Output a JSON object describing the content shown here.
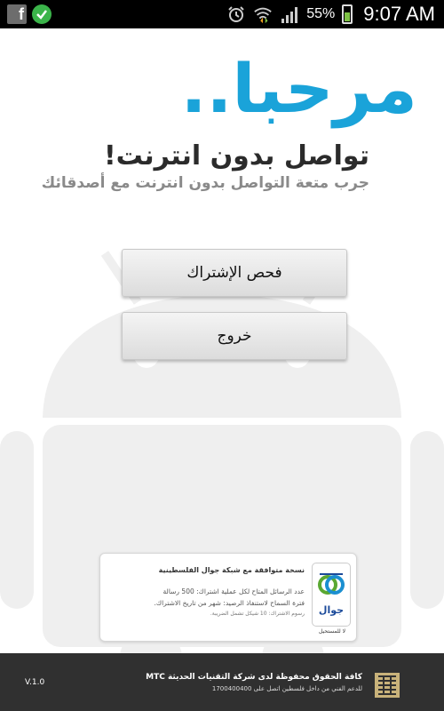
{
  "status_bar": {
    "battery_percent": "55%",
    "battery_level": 0.55,
    "time": "9:07 AM",
    "icons": [
      "facebook-icon",
      "check-icon",
      "alarm-icon",
      "wifi-icon",
      "signal-icon",
      "battery-icon"
    ]
  },
  "header": {
    "welcome": "مرحبا..",
    "tagline": "تواصل بدون انترنت!",
    "subtagline": "جرب متعة التواصل بدون انترنت مع أصدقائك"
  },
  "buttons": {
    "check_subscription": "فحص الإشتراك",
    "exit": "خروج"
  },
  "card": {
    "title": "نسخة متوافقة مع شبكة جوال الفلسطينية",
    "line1": "عدد الرسائل المتاح لكل عملية اشتراك: 500 رسالة",
    "line2": "فترة السماح لاستنفاذ الرصيد: شهر من تاريخ الاشتراك.",
    "line3": "رسوم الاشتراك: 10 شيكل تشمل الضريبة.",
    "logo_word": "جوال",
    "logo_sub": "لا للمستحيل"
  },
  "footer": {
    "version": "V.1.0",
    "rights": "كافة الحقوق محفوظة لدى شركة التقنيات الحديثة MTC",
    "support": "للدعم الفني من داخل فلسطين اتصل على 1700400400"
  },
  "colors": {
    "accent": "#1aa3d9",
    "footer_bg": "#303030",
    "status_bg": "#000000"
  }
}
